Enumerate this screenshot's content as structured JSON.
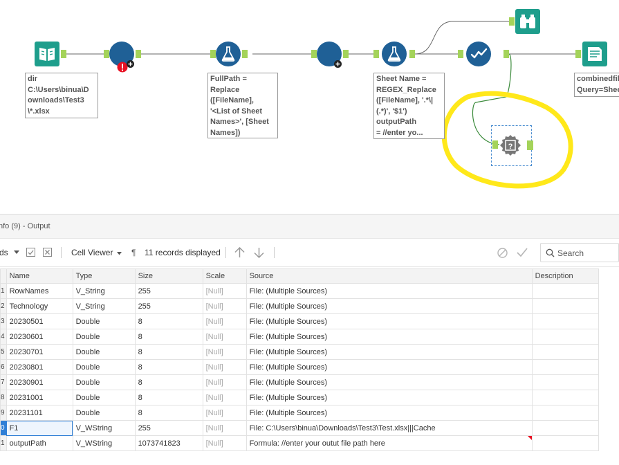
{
  "canvas": {
    "annotations": {
      "input": "dir\nC:\\Users\\binua\\D\nownloads\\Test3\n\\*.xlsx",
      "formula1": "FullPath =\nReplace\n([FileName],\n'<List of Sheet\nNames>', [Sheet\nNames])",
      "formula2": "Sheet Name =\nREGEX_Replace\n([FileName], '.*\\|\n(.*)', '$1')\noutputPath\n= //enter yo...",
      "output": "combinedfil\nQuery=Shee"
    },
    "icons": {
      "directory": "directory-tool-icon",
      "dynamic1": "dynamic-input-tool-icon",
      "formula1": "formula-tool-icon",
      "dynamic2": "dynamic-input-tool-icon",
      "formula2": "formula-tool-icon",
      "select": "select-tool-icon",
      "browse": "browse-tool-icon",
      "output": "output-tool-icon",
      "unknown": "unknown-tool-icon"
    },
    "highlight_color": "#ffe81a",
    "anchor_color": "#a4d35a",
    "tool_color": "#1f6096"
  },
  "panel": {
    "title": "nfo (9) - Output",
    "toolbar": {
      "records_prefix": "ds",
      "cell_viewer": "Cell Viewer",
      "pilcrow": "¶",
      "records_displayed": "11 records displayed",
      "search_placeholder": "Search"
    },
    "columns": [
      "Name",
      "Type",
      "Size",
      "Scale",
      "Source",
      "Description"
    ],
    "rows": [
      {
        "num": "1",
        "name": "RowNames",
        "type": "V_String",
        "size": "255",
        "scale": "[Null]",
        "source": "File: (Multiple Sources)",
        "description": ""
      },
      {
        "num": "2",
        "name": "Technology",
        "type": "V_String",
        "size": "255",
        "scale": "[Null]",
        "source": "File: (Multiple Sources)",
        "description": ""
      },
      {
        "num": "3",
        "name": "20230501",
        "type": "Double",
        "size": "8",
        "scale": "[Null]",
        "source": "File: (Multiple Sources)",
        "description": ""
      },
      {
        "num": "4",
        "name": "20230601",
        "type": "Double",
        "size": "8",
        "scale": "[Null]",
        "source": "File: (Multiple Sources)",
        "description": ""
      },
      {
        "num": "5",
        "name": "20230701",
        "type": "Double",
        "size": "8",
        "scale": "[Null]",
        "source": "File: (Multiple Sources)",
        "description": ""
      },
      {
        "num": "6",
        "name": "20230801",
        "type": "Double",
        "size": "8",
        "scale": "[Null]",
        "source": "File: (Multiple Sources)",
        "description": ""
      },
      {
        "num": "7",
        "name": "20230901",
        "type": "Double",
        "size": "8",
        "scale": "[Null]",
        "source": "File: (Multiple Sources)",
        "description": ""
      },
      {
        "num": "8",
        "name": "20231001",
        "type": "Double",
        "size": "8",
        "scale": "[Null]",
        "source": "File: (Multiple Sources)",
        "description": ""
      },
      {
        "num": "9",
        "name": "20231101",
        "type": "Double",
        "size": "8",
        "scale": "[Null]",
        "source": "File: (Multiple Sources)",
        "description": ""
      },
      {
        "num": "0",
        "name": "F1",
        "type": "V_WString",
        "size": "255",
        "scale": "[Null]",
        "source": "File: C:\\Users\\binua\\Downloads\\Test3\\Test.xlsx|||Cache",
        "description": "",
        "selected": true
      },
      {
        "num": "1",
        "name": "outputPath",
        "type": "V_WString",
        "size": "1073741823",
        "scale": "[Null]",
        "source": "Formula: //enter your outut file path here",
        "description": ""
      }
    ]
  }
}
